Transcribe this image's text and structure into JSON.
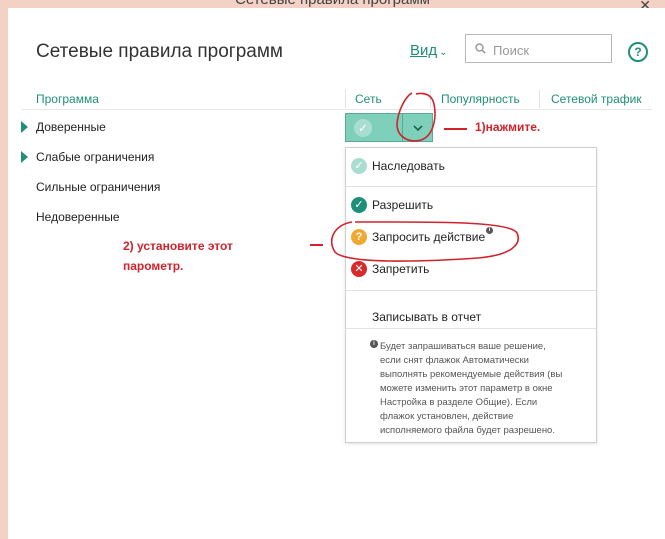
{
  "window": {
    "title": "Сетевые правила программ",
    "close_glyph": "✕"
  },
  "header": {
    "title": "Сетевые правила программ",
    "view_label": "Вид",
    "search_placeholder": "Поиск",
    "help_glyph": "?"
  },
  "table": {
    "columns": [
      "Программа",
      "Сеть",
      "Популярность",
      "Сетевой трафик"
    ],
    "rows": [
      {
        "label": "Доверенные",
        "expandable": true
      },
      {
        "label": "Слабые ограничения",
        "expandable": true
      },
      {
        "label": "Сильные ограничения",
        "expandable": false
      },
      {
        "label": "Недоверенные",
        "expandable": false
      }
    ]
  },
  "network_button": {
    "state_icon": "check-circle-icon",
    "accent": "#7fd0bb"
  },
  "dropdown": {
    "items": [
      {
        "label": "Наследовать",
        "icon": "inherit-check-icon",
        "color": "#a9ddd0"
      },
      {
        "label": "Разрешить",
        "icon": "allow-check-icon",
        "color": "#1f8f79"
      },
      {
        "label": "Запросить действие",
        "icon": "question-icon",
        "color": "#f0a830"
      },
      {
        "label": "Запретить",
        "icon": "deny-x-icon",
        "color": "#d72a2a"
      }
    ],
    "log_label": "Записывать в отчет",
    "info_text": "Будет запрашиваться ваше решение,\nесли снят флажок Автоматически\nвыполнять рекомендуемые действия (вы\nможете изменить этот параметр в окне\nНастройка в разделе Общие). Если\nфлажок установлен, действие\nисполняемого файла будет разрешено."
  },
  "annotations": {
    "step1": "1)нажмите.",
    "step2": "2) установите этот\nпарометр.",
    "color": "#d0232b"
  }
}
